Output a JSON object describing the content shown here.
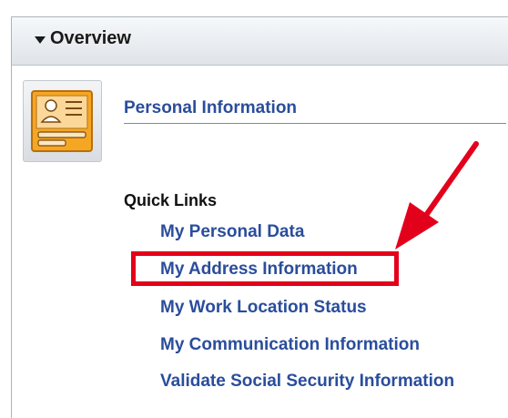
{
  "panel": {
    "title": "Overview",
    "toggle_icon": "triangle-down-icon"
  },
  "section": {
    "icon": "personal-info-card-icon",
    "title": "Personal Information"
  },
  "quick_links": {
    "label": "Quick Links",
    "items": [
      "My Personal Data",
      "My Address Information",
      "My Work Location Status",
      "My Communication Information",
      "Validate Social Security Information"
    ],
    "highlighted_index": 1
  },
  "colors": {
    "link": "#2a4d9c",
    "highlight": "#e3001b",
    "icon_orange": "#f5a623"
  }
}
